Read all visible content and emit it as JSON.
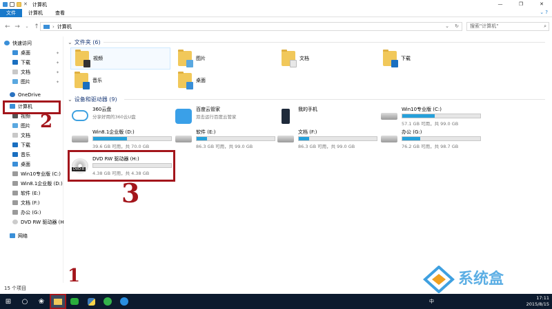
{
  "window": {
    "title": "计算机"
  },
  "ribbon": {
    "tabs": [
      "文件",
      "计算机",
      "查看"
    ]
  },
  "address": {
    "path": "计算机",
    "search_placeholder": "搜索\"计算机\""
  },
  "sidebar": {
    "quick_access": "快速访问",
    "quick_items": [
      "桌面",
      "下载",
      "文档",
      "图片"
    ],
    "onedrive": "OneDrive",
    "computer": "计算机",
    "computer_items": [
      "视频",
      "图片",
      "文档",
      "下载",
      "音乐",
      "桌面",
      "Win10专业版 (C:)",
      "Win8.1企业版 (D:)",
      "软件 (E:)",
      "文档 (F:)",
      "办公 (G:)",
      "DVD RW 驱动器 (H"
    ],
    "network": "网络"
  },
  "folders": {
    "header": "文件夹 (6)",
    "items": [
      "视频",
      "图片",
      "文档",
      "下载",
      "音乐",
      "桌面"
    ]
  },
  "devices": {
    "header": "设备和驱动器 (9)",
    "items": [
      {
        "name": "360云盘",
        "sub": "分享好用的360云U盘"
      },
      {
        "name": "百度云管家",
        "sub": "双击运行百度云管家"
      },
      {
        "name": "我的手机"
      },
      {
        "name": "Win10专业版 (C:)",
        "free": "57.1 GB 可用，共 99.0 GB",
        "used": 0.42
      },
      {
        "name": "Win8.1企业版 (D:)",
        "free": "39.6 GB 可用，共 70.0 GB",
        "used": 0.43
      },
      {
        "name": "软件 (E:)",
        "free": "86.3 GB 可用，共 99.0 GB",
        "used": 0.13
      },
      {
        "name": "文档 (F:)",
        "free": "86.3 GB 可用，共 99.0 GB",
        "used": 0.13
      },
      {
        "name": "办公 (G:)",
        "free": "76.2 GB 可用，共 98.7 GB",
        "used": 0.23
      },
      {
        "name": "DVD RW 驱动器 (H:)",
        "free": "4.38 GB 可用，共 4.38 GB",
        "used": 0.0,
        "disc_label": "DVD-R"
      }
    ]
  },
  "status": {
    "count": "15 个项目"
  },
  "annotations": [
    "2",
    "3",
    "1"
  ],
  "taskbar": {
    "time": "17:11",
    "date": "2015/8/15",
    "lang": "中"
  },
  "watermark": {
    "text": "系统盒"
  },
  "colors": {
    "accent": "#1979ca",
    "bar": "#26a0da",
    "annotation": "#a3151b",
    "taskbar": "#0c1a2e"
  }
}
